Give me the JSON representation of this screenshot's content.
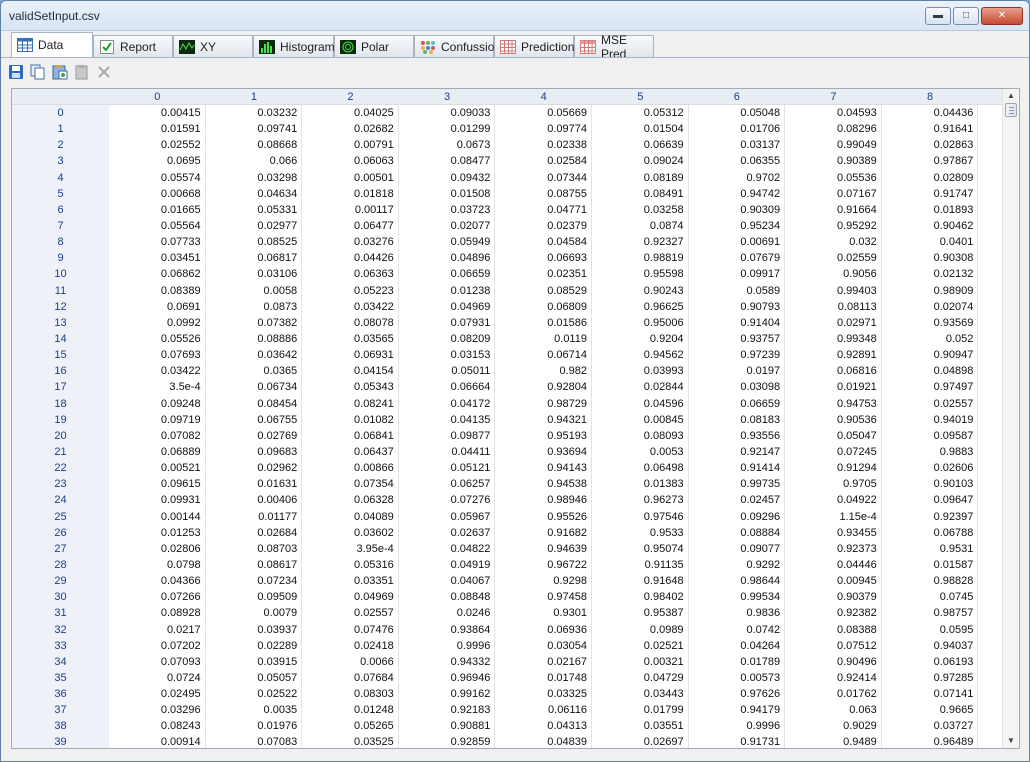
{
  "window": {
    "title": "validSetInput.csv"
  },
  "tabs": [
    {
      "label": "Data",
      "icon": "table-icon",
      "active": true
    },
    {
      "label": "Report",
      "icon": "checkmark-icon",
      "active": false
    },
    {
      "label": "XY",
      "icon": "xy-chart-icon",
      "active": false
    },
    {
      "label": "Histogram",
      "icon": "histogram-icon",
      "active": false
    },
    {
      "label": "Polar",
      "icon": "polar-chart-icon",
      "active": false
    },
    {
      "label": "Confussion",
      "icon": "confusion-matrix-icon",
      "active": false
    },
    {
      "label": "Prediction",
      "icon": "prediction-grid-icon",
      "active": false
    },
    {
      "label": "MSE Pred",
      "icon": "mse-grid-icon",
      "active": false
    }
  ],
  "toolbar": [
    "save-icon",
    "copy-icon",
    "paste-special-icon",
    "clipboard-icon",
    "delete-icon"
  ],
  "columns": [
    "0",
    "1",
    "2",
    "3",
    "4",
    "5",
    "6",
    "7",
    "8"
  ],
  "rows": [
    [
      "0.00415",
      "0.03232",
      "0.04025",
      "0.09033",
      "0.05669",
      "0.05312",
      "0.05048",
      "0.04593",
      "0.04436"
    ],
    [
      "0.01591",
      "0.09741",
      "0.02682",
      "0.01299",
      "0.09774",
      "0.01504",
      "0.01706",
      "0.08296",
      "0.91641"
    ],
    [
      "0.02552",
      "0.08668",
      "0.00791",
      "0.0673",
      "0.02338",
      "0.06639",
      "0.03137",
      "0.99049",
      "0.02863"
    ],
    [
      "0.0695",
      "0.066",
      "0.06063",
      "0.08477",
      "0.02584",
      "0.09024",
      "0.06355",
      "0.90389",
      "0.97867"
    ],
    [
      "0.05574",
      "0.03298",
      "0.00501",
      "0.09432",
      "0.07344",
      "0.08189",
      "0.9702",
      "0.05536",
      "0.02809"
    ],
    [
      "0.00668",
      "0.04634",
      "0.01818",
      "0.01508",
      "0.08755",
      "0.08491",
      "0.94742",
      "0.07167",
      "0.91747"
    ],
    [
      "0.01665",
      "0.05331",
      "0.00117",
      "0.03723",
      "0.04771",
      "0.03258",
      "0.90309",
      "0.91664",
      "0.01893"
    ],
    [
      "0.05564",
      "0.02977",
      "0.06477",
      "0.02077",
      "0.02379",
      "0.0874",
      "0.95234",
      "0.95292",
      "0.90462"
    ],
    [
      "0.07733",
      "0.08525",
      "0.03276",
      "0.05949",
      "0.04584",
      "0.92327",
      "0.00691",
      "0.032",
      "0.0401"
    ],
    [
      "0.03451",
      "0.06817",
      "0.04426",
      "0.04896",
      "0.06693",
      "0.98819",
      "0.07679",
      "0.02559",
      "0.90308"
    ],
    [
      "0.06862",
      "0.03106",
      "0.06363",
      "0.06659",
      "0.02351",
      "0.95598",
      "0.09917",
      "0.9056",
      "0.02132"
    ],
    [
      "0.08389",
      "0.0058",
      "0.05223",
      "0.01238",
      "0.08529",
      "0.90243",
      "0.0589",
      "0.99403",
      "0.98909"
    ],
    [
      "0.0691",
      "0.0873",
      "0.03422",
      "0.04969",
      "0.06809",
      "0.96625",
      "0.90793",
      "0.08113",
      "0.02074"
    ],
    [
      "0.0992",
      "0.07382",
      "0.08078",
      "0.07931",
      "0.01586",
      "0.95006",
      "0.91404",
      "0.02971",
      "0.93569"
    ],
    [
      "0.05526",
      "0.08886",
      "0.03565",
      "0.08209",
      "0.0119",
      "0.9204",
      "0.93757",
      "0.99348",
      "0.052"
    ],
    [
      "0.07693",
      "0.03642",
      "0.06931",
      "0.03153",
      "0.06714",
      "0.94562",
      "0.97239",
      "0.92891",
      "0.90947"
    ],
    [
      "0.03422",
      "0.0365",
      "0.04154",
      "0.05011",
      "0.982",
      "0.03993",
      "0.0197",
      "0.06816",
      "0.04898"
    ],
    [
      "3.5e-4",
      "0.06734",
      "0.05343",
      "0.06664",
      "0.92804",
      "0.02844",
      "0.03098",
      "0.01921",
      "0.97497"
    ],
    [
      "0.09248",
      "0.08454",
      "0.08241",
      "0.04172",
      "0.98729",
      "0.04596",
      "0.06659",
      "0.94753",
      "0.02557"
    ],
    [
      "0.09719",
      "0.06755",
      "0.01082",
      "0.04135",
      "0.94321",
      "0.00845",
      "0.08183",
      "0.90536",
      "0.94019"
    ],
    [
      "0.07082",
      "0.02769",
      "0.06841",
      "0.09877",
      "0.95193",
      "0.08093",
      "0.93556",
      "0.05047",
      "0.09587"
    ],
    [
      "0.06889",
      "0.09683",
      "0.06437",
      "0.04411",
      "0.93694",
      "0.0053",
      "0.92147",
      "0.07245",
      "0.9883"
    ],
    [
      "0.00521",
      "0.02962",
      "0.00866",
      "0.05121",
      "0.94143",
      "0.06498",
      "0.91414",
      "0.91294",
      "0.02606"
    ],
    [
      "0.09615",
      "0.01631",
      "0.07354",
      "0.06257",
      "0.94538",
      "0.01383",
      "0.99735",
      "0.9705",
      "0.90103"
    ],
    [
      "0.09931",
      "0.00406",
      "0.06328",
      "0.07276",
      "0.98946",
      "0.96273",
      "0.02457",
      "0.04922",
      "0.09647"
    ],
    [
      "0.00144",
      "0.01177",
      "0.04089",
      "0.05967",
      "0.95526",
      "0.97546",
      "0.09296",
      "1.15e-4",
      "0.92397"
    ],
    [
      "0.01253",
      "0.02684",
      "0.03602",
      "0.02637",
      "0.91682",
      "0.9533",
      "0.08884",
      "0.93455",
      "0.06788"
    ],
    [
      "0.02806",
      "0.08703",
      "3.95e-4",
      "0.04822",
      "0.94639",
      "0.95074",
      "0.09077",
      "0.92373",
      "0.9531"
    ],
    [
      "0.0798",
      "0.08617",
      "0.05316",
      "0.04919",
      "0.96722",
      "0.91135",
      "0.9292",
      "0.04446",
      "0.01587"
    ],
    [
      "0.04366",
      "0.07234",
      "0.03351",
      "0.04067",
      "0.9298",
      "0.91648",
      "0.98644",
      "0.00945",
      "0.98828"
    ],
    [
      "0.07266",
      "0.09509",
      "0.04969",
      "0.08848",
      "0.97458",
      "0.98402",
      "0.99534",
      "0.90379",
      "0.0745"
    ],
    [
      "0.08928",
      "0.0079",
      "0.02557",
      "0.0246",
      "0.9301",
      "0.95387",
      "0.9836",
      "0.92382",
      "0.98757"
    ],
    [
      "0.0217",
      "0.03937",
      "0.07476",
      "0.93864",
      "0.06936",
      "0.0989",
      "0.0742",
      "0.08388",
      "0.0595"
    ],
    [
      "0.07202",
      "0.02289",
      "0.02418",
      "0.9996",
      "0.03054",
      "0.02521",
      "0.04264",
      "0.07512",
      "0.94037"
    ],
    [
      "0.07093",
      "0.03915",
      "0.0066",
      "0.94332",
      "0.02167",
      "0.00321",
      "0.01789",
      "0.90496",
      "0.06193"
    ],
    [
      "0.0724",
      "0.05057",
      "0.07684",
      "0.96946",
      "0.01748",
      "0.04729",
      "0.00573",
      "0.92414",
      "0.97285"
    ],
    [
      "0.02495",
      "0.02522",
      "0.08303",
      "0.99162",
      "0.03325",
      "0.03443",
      "0.97626",
      "0.01762",
      "0.07141"
    ],
    [
      "0.03296",
      "0.0035",
      "0.01248",
      "0.92183",
      "0.06116",
      "0.01799",
      "0.94179",
      "0.063",
      "0.9665"
    ],
    [
      "0.08243",
      "0.01976",
      "0.05265",
      "0.90881",
      "0.04313",
      "0.03551",
      "0.9996",
      "0.9029",
      "0.03727"
    ],
    [
      "0.00914",
      "0.07083",
      "0.03525",
      "0.92859",
      "0.04839",
      "0.02697",
      "0.91731",
      "0.9489",
      "0.96489"
    ]
  ]
}
